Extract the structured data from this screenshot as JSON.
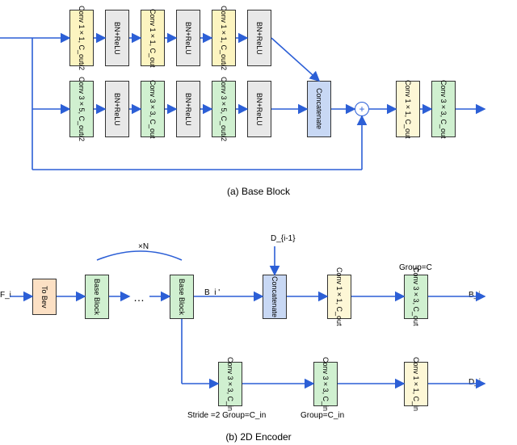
{
  "baseBlock": {
    "caption": "(a)  Base Block",
    "topBranch": [
      "Conv 1×1, C_out/2",
      "BN+ReLU",
      "Conv 1×1, C_out",
      "BN+ReLU",
      "Conv 1×1, C_out/2",
      "BN+ReLU"
    ],
    "bottomBranch": [
      "Conv 3×5, C_out/2",
      "BN+ReLU",
      "Conv 3×3, C_out",
      "BN+ReLU",
      "Conv 3×5, C_out/2",
      "BN+ReLU"
    ],
    "concat": "Concatenate",
    "tail": [
      "Conv 1×1, C_out",
      "Conv 3×3, C_out"
    ]
  },
  "encoder2d": {
    "caption": "(b)  2D Encoder",
    "inputLabel": "F_i",
    "inputTopLabel": "D_{i-1}",
    "toBev": "To Bev",
    "base1": "Base Block",
    "base2": "Base Block",
    "ellipsis": "…",
    "timesN": "×N",
    "bPrime": "B_i '",
    "concat": "Concatenate",
    "topPath": [
      "Conv 1×1, C_out",
      "Conv 3×3, C_out"
    ],
    "topOut": "B_i",
    "groupC": "Group=C",
    "botPath": [
      "Conv 3×3, C_in",
      "Conv 3×3, C_in",
      "Conv 1×1, C_in"
    ],
    "botOut": "D_i",
    "stride2": "Stride =2 Group=C_in",
    "groupCin": "Group=C_in"
  }
}
